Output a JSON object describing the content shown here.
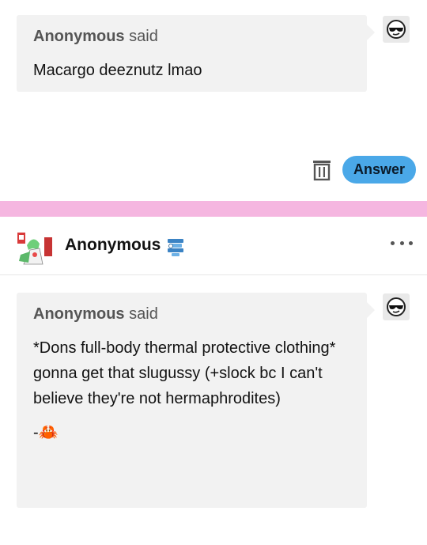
{
  "post1": {
    "asker_name": "Anonymous",
    "asker_said": "said",
    "question": "Macargo deeznutz lmao",
    "avatar_icon": "sunglasses-face-icon"
  },
  "actions": {
    "delete_icon": "trash-icon",
    "answer_label": "Answer",
    "answer_color": "#4aa8e8"
  },
  "separator_color": "#f5b6e0",
  "post2": {
    "blog_name": "Anonymous",
    "avatar_icon": "gardevoir-avatar-icon",
    "badge_icon": "blue-badge-icon",
    "more_icon": "more-options-icon",
    "asker_name": "Anonymous",
    "asker_said": "said",
    "question_lines": [
      "*Dons full-body thermal protective clothing*",
      "gonna get that slugussy (+slock bc I can't believe they're not hermaphrodites)"
    ],
    "signature_prefix": "-",
    "signature_emoji": "🦀",
    "asker_avatar_icon": "sunglasses-face-icon"
  }
}
